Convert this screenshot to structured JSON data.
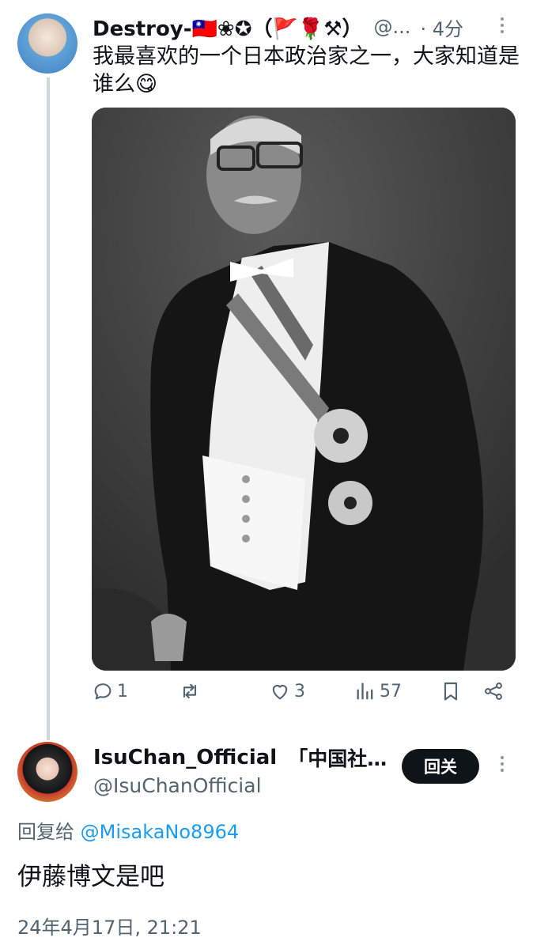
{
  "tweet": {
    "display_name": "Destroy-🇹🇼❀✪（🚩🌹⚒）",
    "handle_truncated": "@...",
    "time": "· 4分",
    "text": "我最喜欢的一个日本政治家之一，大家知道是谁么😋",
    "photo_alt": "black-and-white portrait photograph of a man in formal attire with decorations",
    "stats": {
      "replies": "1",
      "retweets": "",
      "likes": "3",
      "views": "57"
    }
  },
  "reply": {
    "display_name": "IsuChan_Official",
    "display_name_suffix": "「中国社…",
    "handle": "@IsuChanOfficial",
    "follow_label": "回关",
    "reply_prefix": "回复给",
    "reply_mention": "@MisakaNo8964",
    "text": "伊藤博文是吧",
    "timestamp": "24年4月17日, 21:21"
  },
  "icons": [
    "reply-icon",
    "retweet-icon",
    "like-icon",
    "views-icon",
    "bookmark-icon",
    "share-icon",
    "more-icon"
  ]
}
